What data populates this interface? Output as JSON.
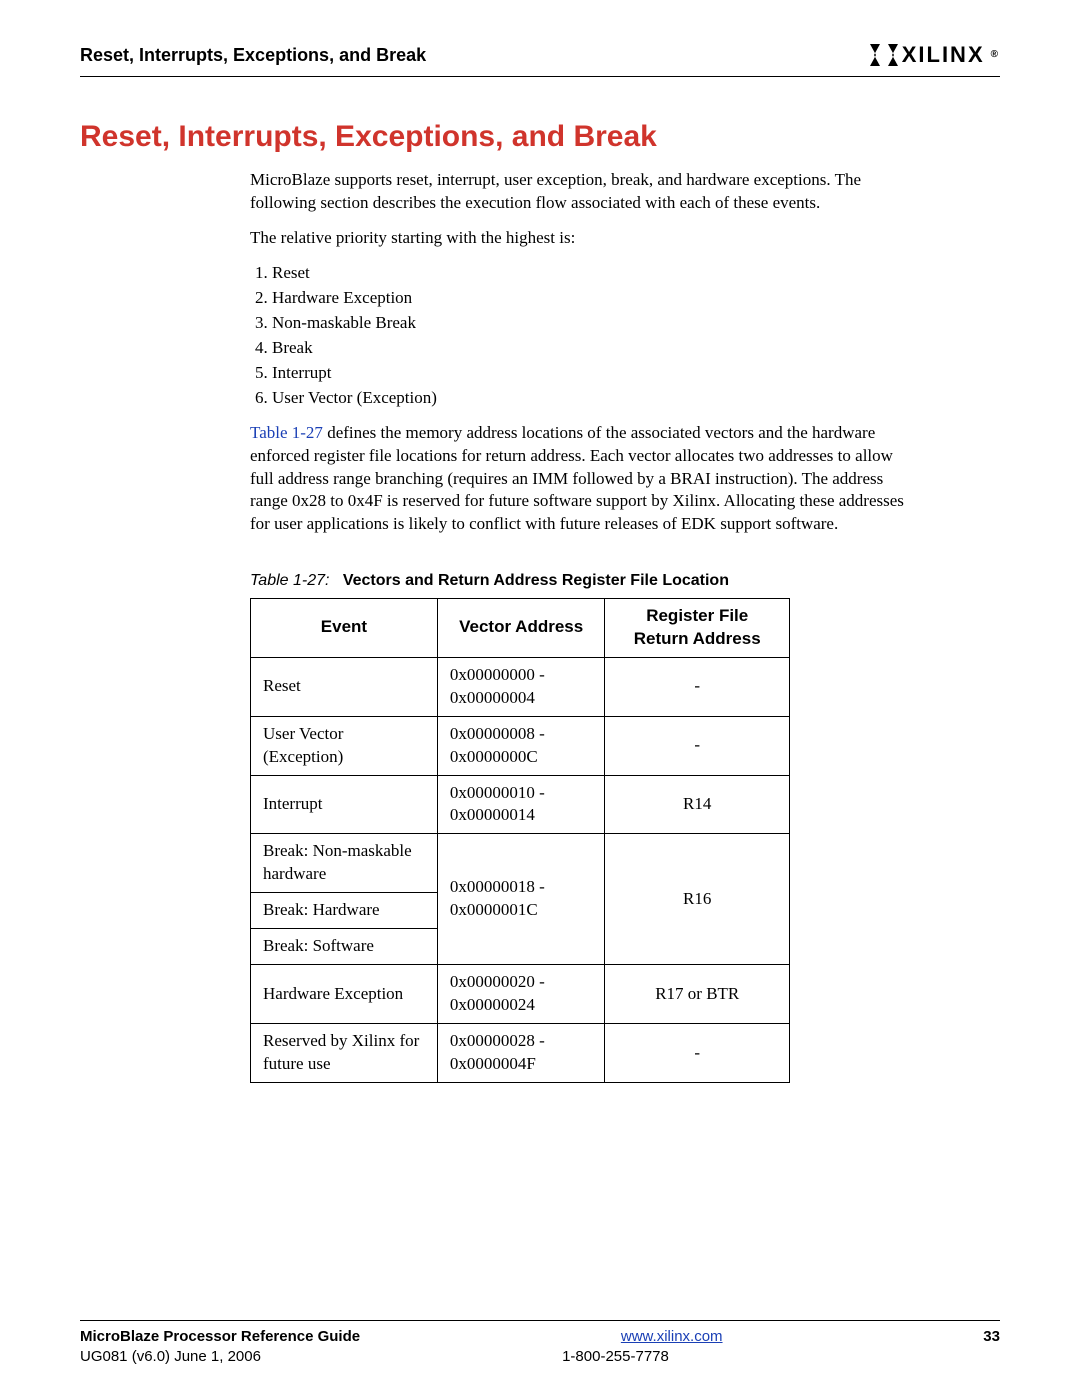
{
  "header": {
    "runningTitle": "Reset, Interrupts, Exceptions, and Break",
    "brand": "XILINX"
  },
  "section": {
    "heading": "Reset, Interrupts, Exceptions, and Break",
    "para1": "MicroBlaze supports reset, interrupt, user exception, break, and hardware exceptions. The following section describes the execution flow associated with each of these events.",
    "para2": "The relative priority starting with the highest is:",
    "priorities": [
      "Reset",
      "Hardware Exception",
      "Non-maskable Break",
      "Break",
      "Interrupt",
      "User Vector (Exception)"
    ],
    "para3a": "Table 1-27",
    "para3b": " defines the memory address locations of the associated vectors and the hardware enforced register file locations for return address. Each vector allocates two addresses to allow full address range branching (requires an IMM followed by a BRAI instruction). The address range 0x28 to 0x4F is reserved for future software support by Xilinx. Allocating these addresses for user applications is likely to conflict with future releases of EDK support software."
  },
  "table": {
    "captionLabel": "Table 1-27:",
    "captionTitle": "Vectors and Return Address Register File Location",
    "headers": {
      "event": "Event",
      "vector": "Vector Address",
      "ret": "Register File Return Address"
    },
    "rows": [
      {
        "event": "Reset",
        "addr": "0x00000000 - 0x00000004",
        "ret": "-"
      },
      {
        "event": "User Vector (Exception)",
        "addr": "0x00000008 - 0x0000000C",
        "ret": "-"
      },
      {
        "event": "Interrupt",
        "addr": "0x00000010 - 0x00000014",
        "ret": "R14"
      },
      {
        "event": "Break: Non-maskable hardware",
        "addr": "0x00000018 - 0x0000001C",
        "ret": "R16"
      },
      {
        "event": "Break: Hardware",
        "addr": "",
        "ret": ""
      },
      {
        "event": "Break: Software",
        "addr": "",
        "ret": ""
      },
      {
        "event": "Hardware Exception",
        "addr": "0x00000020 - 0x00000024",
        "ret": "R17 or BTR"
      },
      {
        "event": "Reserved by Xilinx for future use",
        "addr": "0x00000028 - 0x0000004F",
        "ret": "-"
      }
    ]
  },
  "footer": {
    "guide": "MicroBlaze Processor Reference Guide",
    "url": "www.xilinx.com",
    "page": "33",
    "docid": "UG081 (v6.0) June 1, 2006",
    "phone": "1-800-255-7778"
  }
}
